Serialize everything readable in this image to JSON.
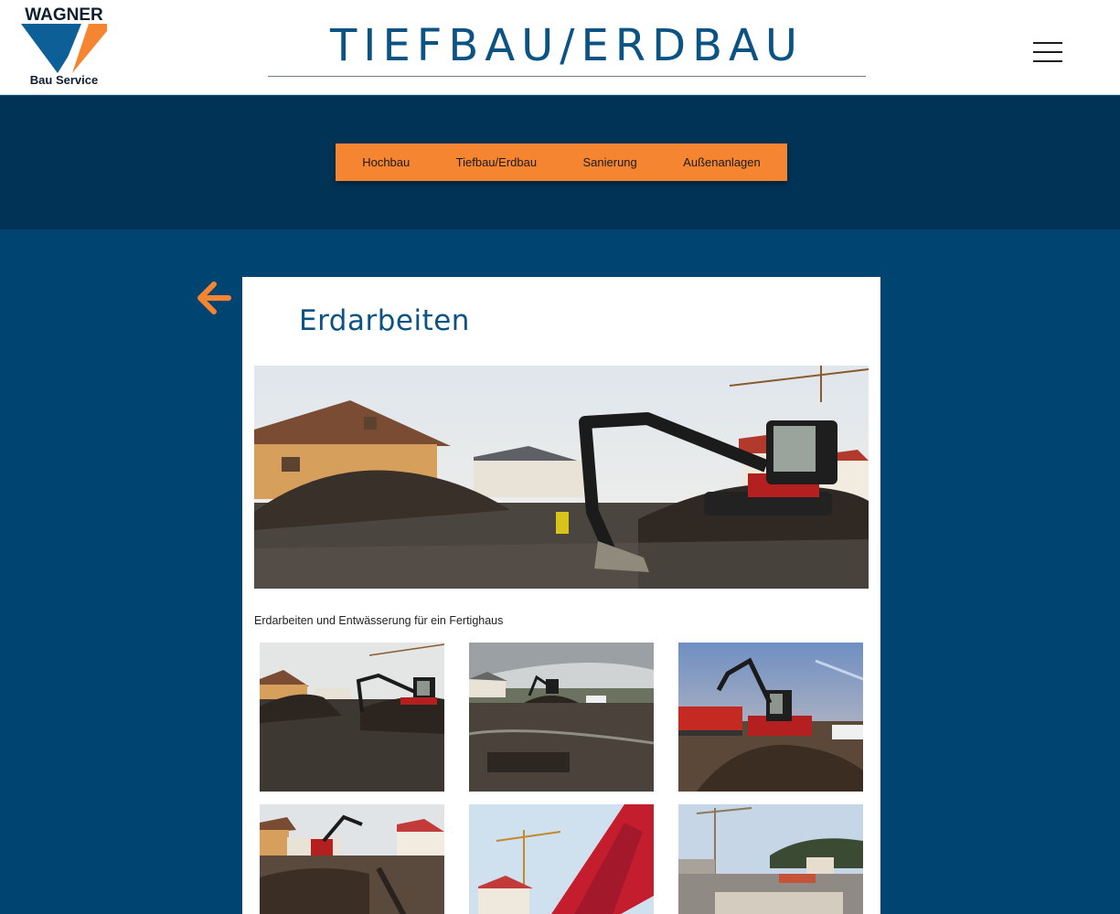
{
  "brand": {
    "logo_name": "WAGNER",
    "logo_sub": "Bau Service",
    "colors": {
      "blue": "#0b5383",
      "orange": "#f58530",
      "dark_navy": "#003355",
      "navy": "#004472"
    }
  },
  "header": {
    "title": "TIEFBAU/ERDBAU",
    "menu_icon": "hamburger-menu-icon"
  },
  "nav": {
    "items": [
      {
        "label": "Hochbau"
      },
      {
        "label": "Tiefbau/Erdbau"
      },
      {
        "label": "Sanierung"
      },
      {
        "label": "Außenanlagen"
      }
    ]
  },
  "back": {
    "icon": "arrow-left-icon"
  },
  "project": {
    "title": "Erdarbeiten",
    "caption": "Erdarbeiten und Entwässerung für ein Fertighaus",
    "hero_image": "excavator-construction-site-photo",
    "gallery": [
      {
        "image": "excavator-dirt-mound-photo"
      },
      {
        "image": "muddy-building-plot-photo"
      },
      {
        "image": "excavator-loading-truck-photo"
      },
      {
        "image": "excavator-near-houses-photo"
      },
      {
        "image": "red-dump-truck-photo"
      },
      {
        "image": "finished-site-with-crane-photo"
      }
    ]
  }
}
